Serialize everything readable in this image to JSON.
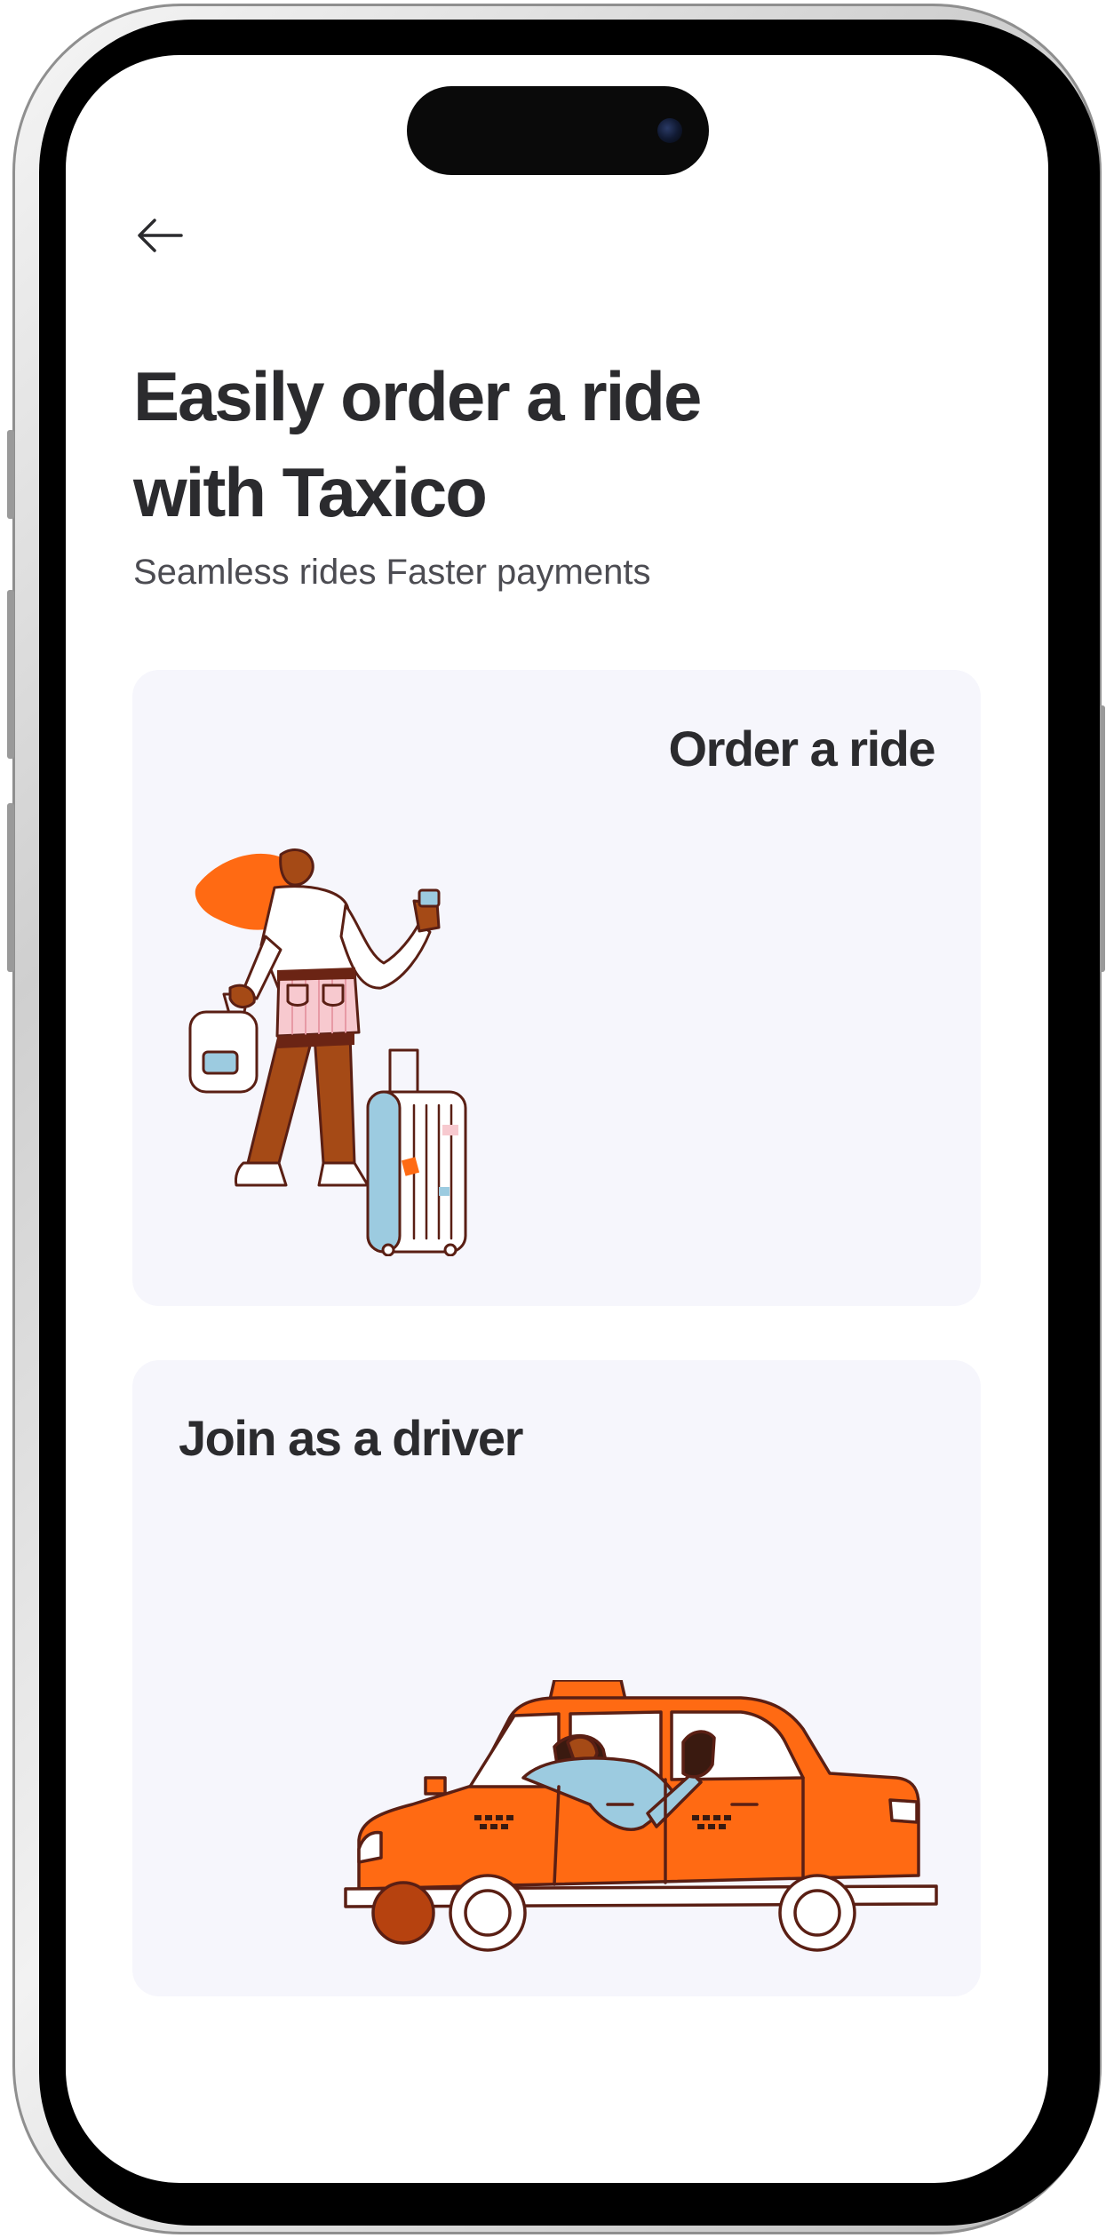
{
  "header": {
    "back_icon": "arrow-left-icon"
  },
  "hero": {
    "title_line1": "Easily order a ride",
    "title_line2": "with Taxico",
    "subtitle": "Seamless rides Faster payments"
  },
  "options": {
    "order_ride": {
      "label": "Order a ride",
      "illustration": "woman-with-luggage-illustration"
    },
    "join_driver": {
      "label": "Join as a driver",
      "illustration": "taxi-driver-illustration"
    }
  },
  "colors": {
    "accent_orange": "#ff6a13",
    "outline_brown": "#5a1f14",
    "card_background": "#f6f6fc",
    "text_primary": "#2b2b2e"
  }
}
